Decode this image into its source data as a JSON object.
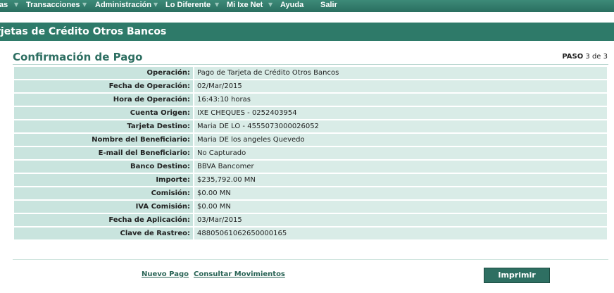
{
  "nav": {
    "items": [
      "as",
      "Transacciones",
      "Administración",
      "Lo Diferente",
      "Mi Ixe Net",
      "Ayuda",
      "Salir"
    ]
  },
  "section_title": "rjetas de Crédito Otros Bancos",
  "page_title": "Confirmación de Pago",
  "step": {
    "label": "PASO",
    "text": "3 de 3"
  },
  "details": [
    {
      "label": "Operación:",
      "value": "Pago de Tarjeta de Crédito Otros Bancos"
    },
    {
      "label": "Fecha de Operación:",
      "value": "02/Mar/2015"
    },
    {
      "label": "Hora de Operación:",
      "value": "16:43:10 horas"
    },
    {
      "label": "Cuenta Origen:",
      "value": "IXE CHEQUES - 0252403954"
    },
    {
      "label": "Tarjeta Destino:",
      "value": "Maria DE LO - 4555073000026052"
    },
    {
      "label": "Nombre del Beneficiario:",
      "value": "Maria DE los angeles Quevedo"
    },
    {
      "label": "E-mail del Beneficiario:",
      "value": "No Capturado"
    },
    {
      "label": "Banco Destino:",
      "value": "BBVA Bancomer"
    },
    {
      "label": "Importe:",
      "value": "$235,792.00 MN"
    },
    {
      "label": "Comisión:",
      "value": "$0.00 MN"
    },
    {
      "label": "IVA Comisión:",
      "value": "$0.00 MN"
    },
    {
      "label": "Fecha de Aplicación:",
      "value": "03/Mar/2015"
    },
    {
      "label": "Clave de Rastreo:",
      "value": "48805061062650000165"
    }
  ],
  "actions": {
    "new_payment": "Nuevo Pago",
    "view_movements": "Consultar Movimientos",
    "print": "Imprimir"
  },
  "colors": {
    "nav_bar": "#2e7a69",
    "section_header": "#2e7a69",
    "label_cell": "#c9e4de",
    "value_cell": "#d9ece7",
    "title_text": "#2e6f62"
  }
}
